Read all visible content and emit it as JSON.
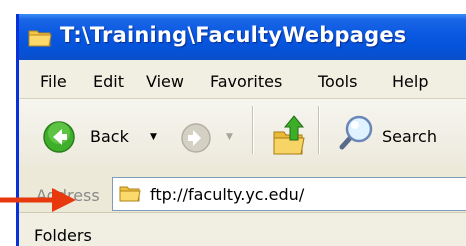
{
  "window": {
    "title": "T:\\Training\\FacultyWebpages",
    "icon": "folder-icon"
  },
  "menu": {
    "items": [
      "File",
      "Edit",
      "View",
      "Favorites",
      "Tools",
      "Help"
    ]
  },
  "toolbar": {
    "back_label": "Back",
    "search_label": "Search",
    "icons": [
      "back-arrow-icon",
      "forward-arrow-icon",
      "up-folder-icon",
      "search-magnifier-icon"
    ]
  },
  "address": {
    "label": "Address",
    "value": "ftp://faculty.yc.edu/"
  },
  "panel": {
    "folders_label": "Folders"
  },
  "annotation": {
    "arrow_color": "#e8380d"
  },
  "colors": {
    "titlebar": "#0a58e2",
    "chrome": "#ece9d8"
  }
}
